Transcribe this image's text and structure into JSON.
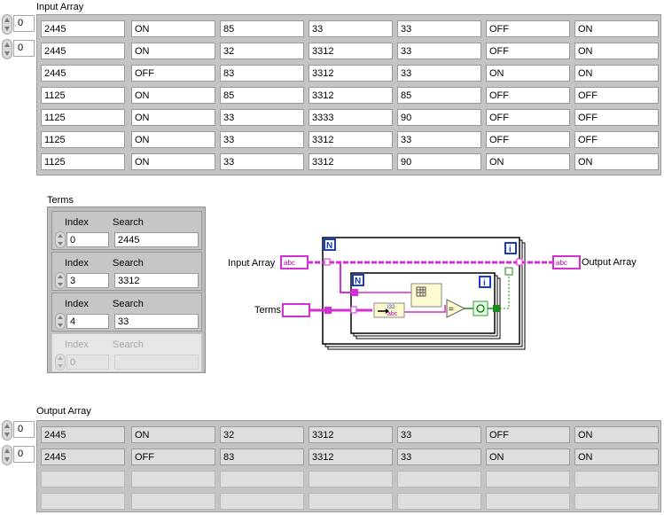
{
  "input_array": {
    "label": "Input Array",
    "index_row": "0",
    "index_col": "0",
    "rows": [
      [
        "2445",
        "ON",
        "85",
        "33",
        "33",
        "OFF",
        "ON"
      ],
      [
        "2445",
        "ON",
        "32",
        "3312",
        "33",
        "OFF",
        "ON"
      ],
      [
        "2445",
        "OFF",
        "83",
        "3312",
        "33",
        "ON",
        "ON"
      ],
      [
        "1125",
        "ON",
        "85",
        "3312",
        "85",
        "OFF",
        "OFF"
      ],
      [
        "1125",
        "ON",
        "33",
        "3333",
        "90",
        "OFF",
        "OFF"
      ],
      [
        "1125",
        "ON",
        "33",
        "3312",
        "33",
        "OFF",
        "OFF"
      ],
      [
        "1125",
        "ON",
        "33",
        "3312",
        "90",
        "ON",
        "ON"
      ]
    ]
  },
  "terms": {
    "label": "Terms",
    "index_header": "Index",
    "search_header": "Search",
    "items": [
      {
        "index": "0",
        "search": "2445"
      },
      {
        "index": "3",
        "search": "3312"
      },
      {
        "index": "4",
        "search": "33"
      },
      {
        "index": "0",
        "search": ""
      }
    ]
  },
  "diagram": {
    "input_label": "Input Array",
    "terms_label": "Terms",
    "output_label": "Output Array",
    "string_terminal": "abc",
    "n_glyph": "N",
    "i_glyph": "i",
    "i32_glyph": "I32",
    "equal_glyph": "="
  },
  "output_array": {
    "label": "Output Array",
    "index_row": "0",
    "index_col": "0",
    "rows": [
      [
        "2445",
        "ON",
        "32",
        "3312",
        "33",
        "OFF",
        "ON"
      ],
      [
        "2445",
        "OFF",
        "83",
        "3312",
        "33",
        "ON",
        "ON"
      ]
    ],
    "empty_rows": 2
  },
  "colors": {
    "string_wire": "#d42fd4",
    "bool_wire": "#1a8a1a",
    "loop_border": "#000000",
    "frame": "#c4c4c4"
  }
}
